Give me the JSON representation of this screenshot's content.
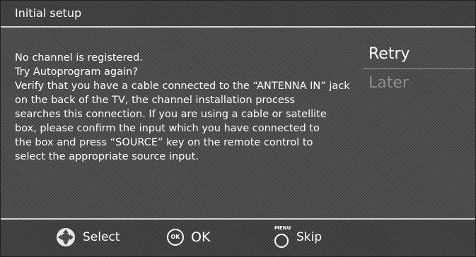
{
  "title": "Initial setup",
  "message": [
    "No channel is registered.",
    "Try Autoprogram again?",
    "Verify that you have a cable connected to the “ANTENNA IN” jack",
    "on the back of the TV, the channel installation process",
    "searches this connection. If you are using a cable or satellite",
    "box, please confirm the input which you have connected to",
    "the box and press “SOURCE” key on the remote control to",
    "select the appropriate source input."
  ],
  "options": [
    {
      "label": "Retry",
      "state": "selected"
    },
    {
      "label": "Later",
      "state": "disabled"
    }
  ],
  "footer": {
    "select_label": "Select",
    "ok_icon_text": "OK",
    "ok_label": "OK",
    "menu_icon_text": "MENU",
    "skip_label": "Skip"
  },
  "icons": {
    "select": "dpad-icon",
    "ok": "ok-button-icon",
    "skip": "menu-button-icon"
  },
  "colors": {
    "text": "#ffffff",
    "disabled_text": "#8d8d8d",
    "divider": "#d8d8d8"
  }
}
